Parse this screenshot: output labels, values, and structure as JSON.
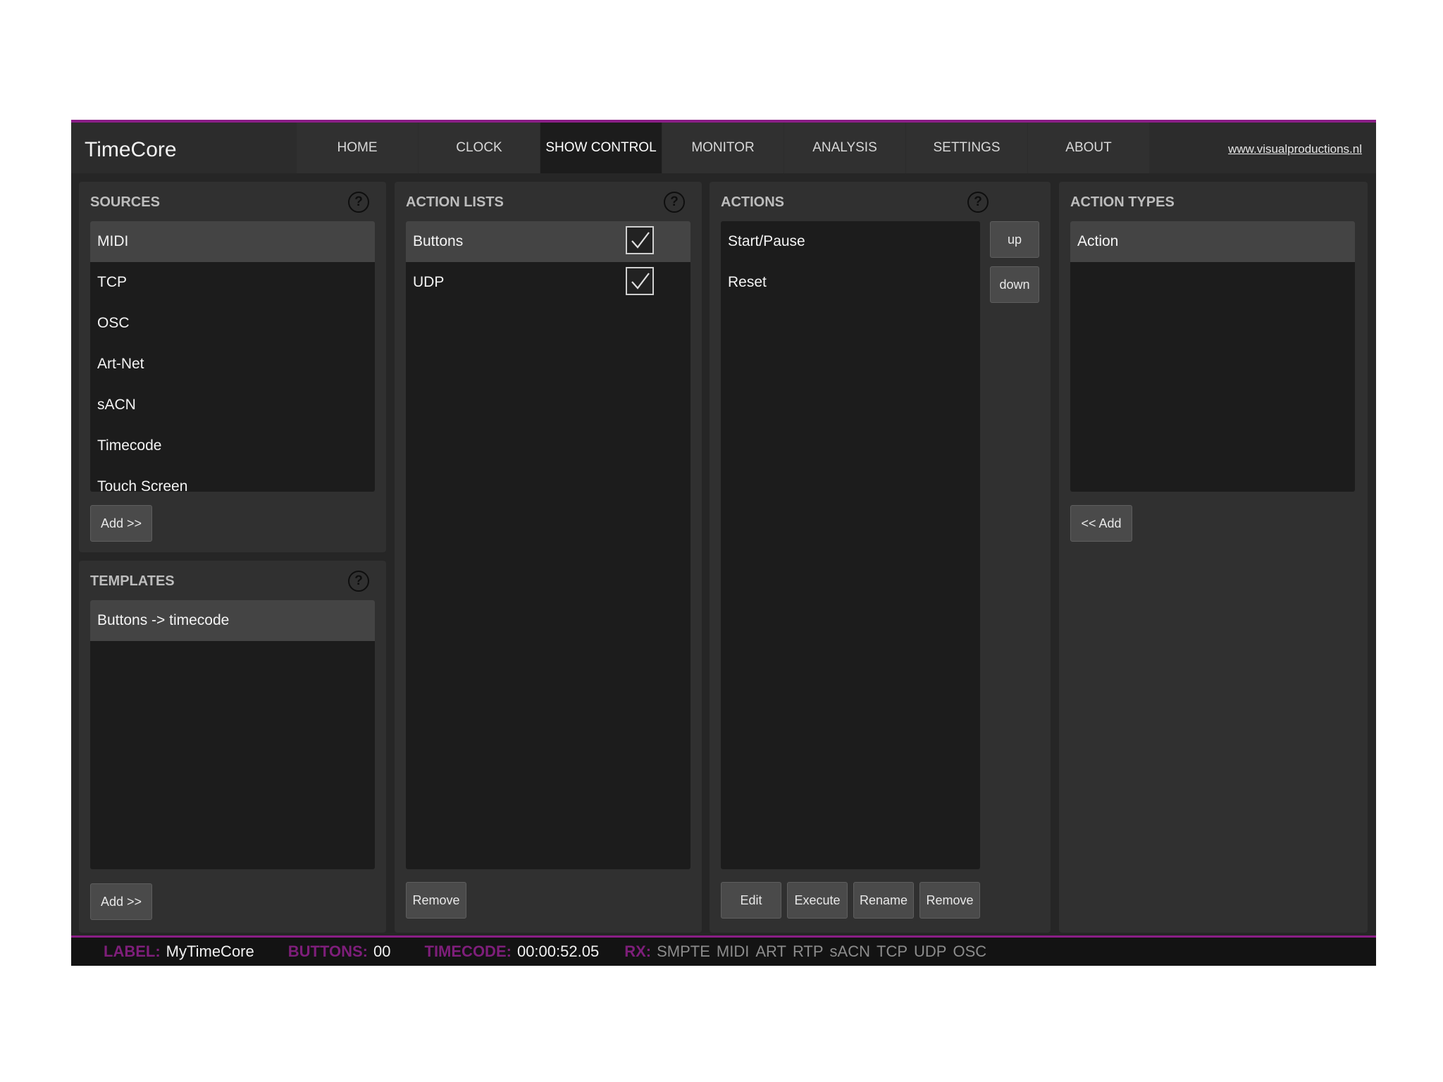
{
  "app": {
    "title": "TimeCore",
    "website": "www.visualproductions.nl"
  },
  "nav": {
    "tabs": [
      {
        "label": "HOME"
      },
      {
        "label": "CLOCK"
      },
      {
        "label": "SHOW CONTROL",
        "active": true
      },
      {
        "label": "MONITOR"
      },
      {
        "label": "ANALYSIS"
      },
      {
        "label": "SETTINGS"
      },
      {
        "label": "ABOUT"
      }
    ]
  },
  "sources": {
    "title": "SOURCES",
    "items": [
      "MIDI",
      "TCP",
      "OSC",
      "Art-Net",
      "sACN",
      "Timecode",
      "Touch Screen"
    ],
    "selected": "MIDI",
    "add_label": "Add >>"
  },
  "templates": {
    "title": "TEMPLATES",
    "items": [
      "Buttons -> timecode"
    ],
    "selected": "Buttons -> timecode",
    "add_label": "Add >>"
  },
  "action_lists": {
    "title": "ACTION LISTS",
    "items": [
      {
        "label": "Buttons",
        "checked": true
      },
      {
        "label": "UDP",
        "checked": true
      }
    ],
    "selected": "Buttons",
    "remove_label": "Remove"
  },
  "actions": {
    "title": "ACTIONS",
    "items": [
      "Start/Pause",
      "Reset"
    ],
    "up_label": "up",
    "down_label": "down",
    "edit_label": "Edit",
    "execute_label": "Execute",
    "rename_label": "Rename",
    "remove_label": "Remove"
  },
  "action_types": {
    "title": "ACTION TYPES",
    "items": [
      "Action"
    ],
    "selected": "Action",
    "add_label": "<< Add"
  },
  "help_icon": "question-circle-icon",
  "status": {
    "label_key": "LABEL:",
    "label_value": "MyTimeCore",
    "buttons_key": "BUTTONS:",
    "buttons_value": "00",
    "timecode_key": "TIMECODE:",
    "timecode_value": "00:00:52.05",
    "rx_key": "RX:",
    "rx_items": [
      "SMPTE",
      "MIDI",
      "ART",
      "RTP",
      "sACN",
      "TCP",
      "UDP",
      "OSC"
    ]
  },
  "colors": {
    "accent": "#8a1e86",
    "status_key": "#7e1e7a",
    "background": "#262626",
    "panel": "#303030",
    "list": "#1c1c1c",
    "selected_row": "#444444"
  }
}
